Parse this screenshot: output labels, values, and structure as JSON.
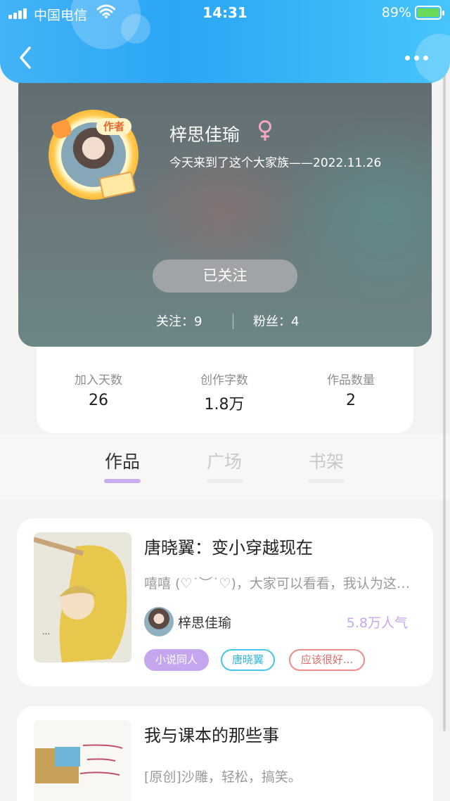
{
  "status_bar": {
    "carrier": "中国电信",
    "time": "14:31",
    "battery": "89%"
  },
  "colors": {
    "header": "#2aa6f5",
    "accent_purple": "#c5a7f0",
    "tag_blue": "#31b5dc",
    "tag_red": "#e06b6b"
  },
  "profile": {
    "badge": "作者",
    "name": "梓思佳瑜",
    "gender_icon": "female-symbol",
    "intro": "今天来到了这个大家族——2022.11.26",
    "follow_button": "已关注",
    "following": "关注：9",
    "followers": "粉丝：4"
  },
  "stats": [
    {
      "label": "加入天数",
      "value": "26"
    },
    {
      "label": "创作字数",
      "value": "1.8万"
    },
    {
      "label": "作品数量",
      "value": "2"
    }
  ],
  "tabs": [
    "作品",
    "广场",
    "书架"
  ],
  "works": [
    {
      "title": "唐晓翼：变小穿越现在",
      "desc": "嘻嘻 (♡˙︶˙♡)，大家可以看看，我认为这个作品还不错，希望大家喜欢",
      "author": "梓思佳瑜",
      "popularity": "5.8万人气",
      "tags": [
        "小说同人",
        "唐晓翼",
        "应该很好..."
      ]
    },
    {
      "title": "我与课本的那些事",
      "desc": "[原创]沙雕，轻松，搞笑。"
    }
  ]
}
